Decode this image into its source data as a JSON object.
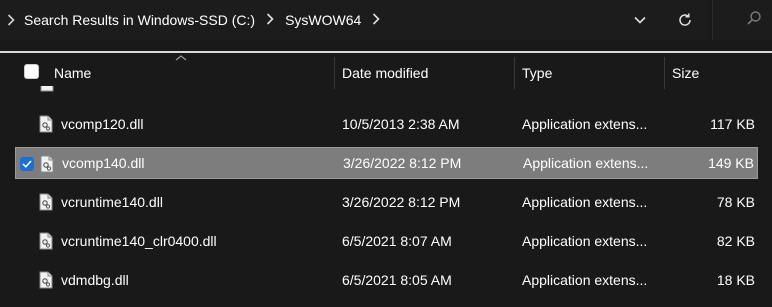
{
  "breadcrumb": {
    "items": [
      "Search Results in Windows-SSD (C:)",
      "SysWOW64"
    ]
  },
  "columns": {
    "name": "Name",
    "date": "Date modified",
    "type": "Type",
    "size": "Size"
  },
  "files": [
    {
      "name": "vcomp120.dll",
      "date": "10/5/2013 2:38 AM",
      "type": "Application extens...",
      "size": "117 KB",
      "selected": false
    },
    {
      "name": "vcomp140.dll",
      "date": "3/26/2022 8:12 PM",
      "type": "Application extens...",
      "size": "149 KB",
      "selected": true
    },
    {
      "name": "vcruntime140.dll",
      "date": "3/26/2022 8:12 PM",
      "type": "Application extens...",
      "size": "78 KB",
      "selected": false
    },
    {
      "name": "vcruntime140_clr0400.dll",
      "date": "6/5/2021 8:07 AM",
      "type": "Application extens...",
      "size": "82 KB",
      "selected": false
    },
    {
      "name": "vdmdbg.dll",
      "date": "6/5/2021 8:05 AM",
      "type": "Application extens...",
      "size": "18 KB",
      "selected": false
    }
  ],
  "theme": {
    "background": "#191919",
    "selection": "#7d7d7d",
    "accent": "#1f6fcf"
  },
  "icons": {
    "address_chevron": "chevron-right-icon",
    "dropdown": "chevron-down-icon",
    "refresh": "refresh-icon",
    "search": "search-icon",
    "file": "dll-file-icon"
  }
}
